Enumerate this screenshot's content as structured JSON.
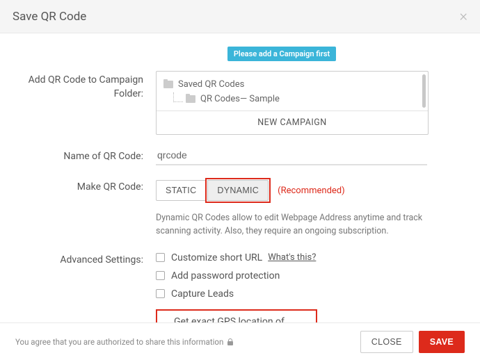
{
  "header": {
    "title": "Save QR Code"
  },
  "badge": "Please add a Campaign first",
  "labels": {
    "folder": "Add QR Code to Campaign Folder:",
    "name": "Name of QR Code:",
    "make": "Make QR Code:",
    "advanced": "Advanced Settings:"
  },
  "folder": {
    "root": "Saved QR Codes",
    "child": "QR Codes— Sample",
    "new_campaign": "NEW CAMPAIGN"
  },
  "name_value": "qrcode",
  "mode": {
    "static": "STATIC",
    "dynamic": "DYNAMIC",
    "recommended": "(Recommended)",
    "help": "Dynamic QR Codes allow to edit Webpage Address anytime and track scanning activity. Also, they require an ongoing subscription."
  },
  "advanced": {
    "customize": "Customize short URL",
    "whats_this": "What's this?",
    "password": "Add password protection",
    "capture": "Capture Leads",
    "gps": "Get exact GPS location of scan"
  },
  "footer": {
    "disclaimer": "You agree that you are authorized to share this information",
    "close": "CLOSE",
    "save": "SAVE"
  }
}
